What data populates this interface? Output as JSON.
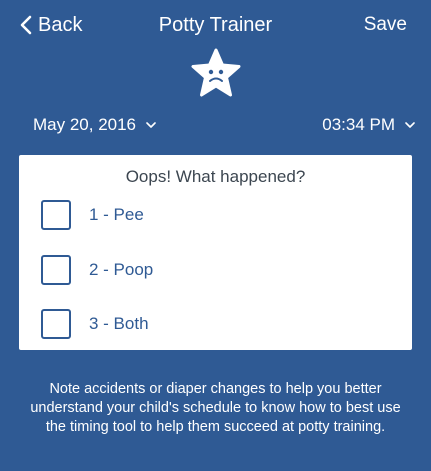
{
  "nav": {
    "back_label": "Back",
    "title": "Potty Trainer",
    "save_label": "Save"
  },
  "datetime": {
    "date": "May 20, 2016",
    "time": "03:34 PM"
  },
  "card": {
    "question": "Oops! What happened?",
    "options": [
      {
        "label": "1 - Pee",
        "checked": false
      },
      {
        "label": "2 - Poop",
        "checked": false
      },
      {
        "label": "3 - Both",
        "checked": false
      }
    ]
  },
  "note": "Note accidents or diaper changes to help you better understand your child's schedule to know how to best use the timing tool to help them succeed at potty training.",
  "colors": {
    "background": "#2f5a94",
    "card": "#ffffff",
    "accent": "#2f5a94"
  }
}
